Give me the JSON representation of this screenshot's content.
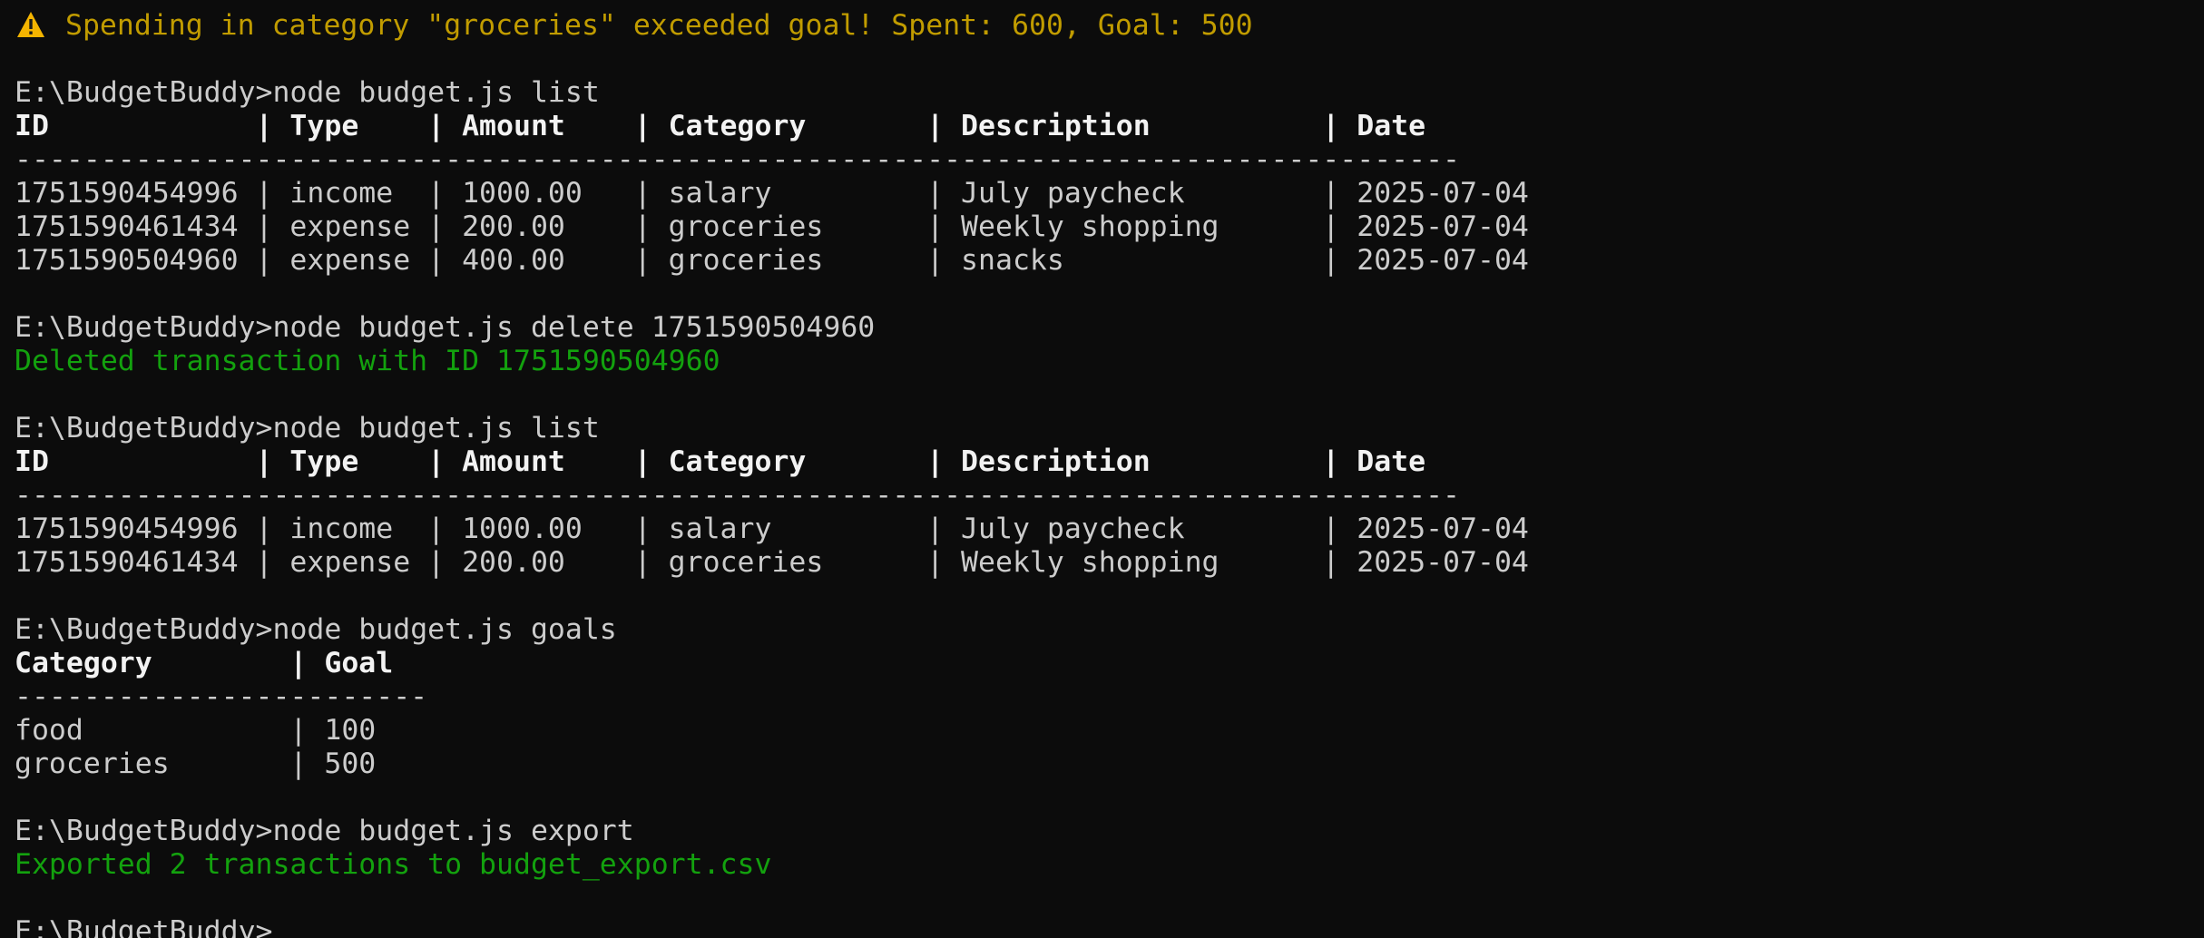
{
  "warning": {
    "icon": "warning-icon",
    "text": "Spending in category \"groceries\" exceeded goal! Spent: 600, Goal: 500"
  },
  "colors": {
    "background": "#0c0c0c",
    "text": "#cccccc",
    "warning": "#c19c00",
    "success": "#13a10e"
  },
  "cmd1": {
    "prompt": "E:\\BudgetBuddy>",
    "command": "node budget.js list"
  },
  "table1": {
    "header": "ID            | Type    | Amount    | Category       | Description          | Date",
    "separator": "------------------------------------------------------------------------------------",
    "rows": [
      "1751590454996 | income  | 1000.00   | salary         | July paycheck        | 2025-07-04",
      "1751590461434 | expense | 200.00    | groceries      | Weekly shopping      | 2025-07-04",
      "1751590504960 | expense | 400.00    | groceries      | snacks               | 2025-07-04"
    ]
  },
  "cmd2": {
    "prompt": "E:\\BudgetBuddy>",
    "command": "node budget.js delete 1751590504960"
  },
  "delete_msg": "Deleted transaction with ID 1751590504960",
  "cmd3": {
    "prompt": "E:\\BudgetBuddy>",
    "command": "node budget.js list"
  },
  "table2": {
    "header": "ID            | Type    | Amount    | Category       | Description          | Date",
    "separator": "------------------------------------------------------------------------------------",
    "rows": [
      "1751590454996 | income  | 1000.00   | salary         | July paycheck        | 2025-07-04",
      "1751590461434 | expense | 200.00    | groceries      | Weekly shopping      | 2025-07-04"
    ]
  },
  "cmd4": {
    "prompt": "E:\\BudgetBuddy>",
    "command": "node budget.js goals"
  },
  "goals": {
    "header": "Category        | Goal",
    "separator": "------------------------",
    "rows": [
      "food            | 100",
      "groceries       | 500"
    ]
  },
  "cmd5": {
    "prompt": "E:\\BudgetBuddy>",
    "command": "node budget.js export"
  },
  "export_msg": "Exported 2 transactions to budget_export.csv",
  "final_prompt": "E:\\BudgetBuddy>"
}
